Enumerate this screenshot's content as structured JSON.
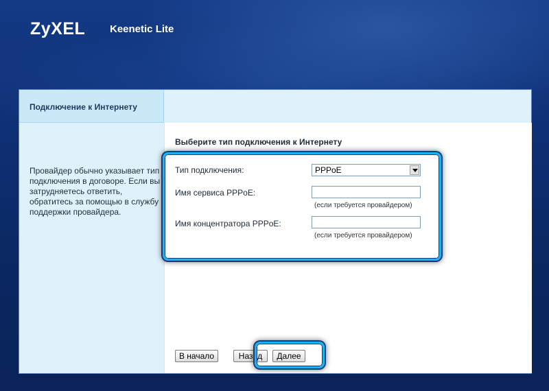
{
  "header": {
    "brand": "ZyXEL",
    "product": "Keenetic Lite"
  },
  "tab": {
    "label": "Подключение к Интернету"
  },
  "sidebar": {
    "help_text": "Провайдер обычно указывает тип подключения в договоре. Если вы затрудняетесь ответить, обратитесь за помощью в службу поддержки провайдера."
  },
  "form": {
    "heading": "Выберите тип подключения к Интернету",
    "connection_type_label": "Тип подключения:",
    "connection_type_value": "PPPoE",
    "service_name_label": "Имя сервиса PPPoE:",
    "service_name_value": "",
    "service_name_hint": "(если требуется провайдером)",
    "concentrator_label": "Имя концентратора PPPoE:",
    "concentrator_value": "",
    "concentrator_hint": "(если требуется провайдером)"
  },
  "buttons": {
    "start": "В начало",
    "back": "Назад",
    "next": "Далее"
  },
  "colors": {
    "highlight": "#1fb0f0",
    "background": "#0e2f73",
    "sidebar": "#dff1fb"
  }
}
